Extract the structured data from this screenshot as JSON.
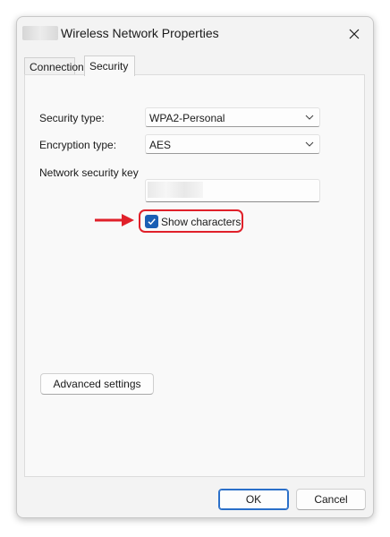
{
  "window": {
    "title": "Wireless Network Properties",
    "close_icon": "close-icon"
  },
  "tabs": [
    {
      "label": "Connection",
      "selected": false
    },
    {
      "label": "Security",
      "selected": true
    }
  ],
  "security": {
    "security_type_label": "Security type:",
    "security_type_value": "WPA2-Personal",
    "encryption_type_label": "Encryption type:",
    "encryption_type_value": "AES",
    "network_key_label": "Network security key",
    "show_characters_label": "Show characters",
    "show_characters_checked": true,
    "advanced_settings_label": "Advanced settings"
  },
  "footer": {
    "ok_label": "OK",
    "cancel_label": "Cancel"
  },
  "colors": {
    "accent": "#1a5fb4",
    "highlight": "#e0202a"
  }
}
